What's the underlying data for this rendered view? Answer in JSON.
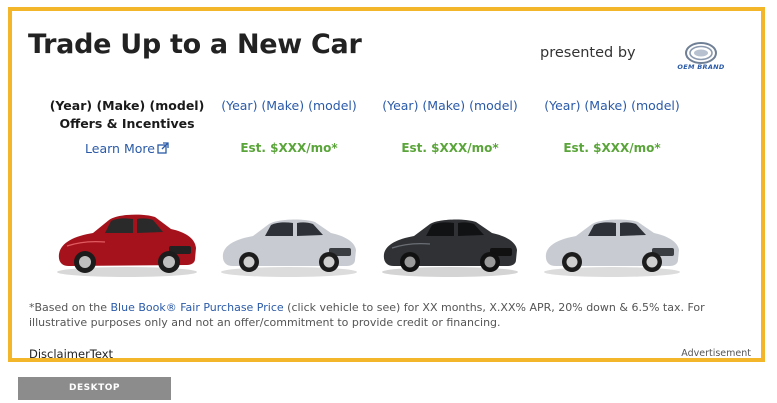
{
  "ad": {
    "title": "Trade Up to a New Car",
    "presented_by": "presented by",
    "brand_logo_text": "OEM BRAND",
    "columns": [
      {
        "heading_line1": "(Year) (Make) (model)",
        "heading_line2": "Offers & Incentives",
        "link_label": "Learn More",
        "link_icon": "external-link-icon",
        "car_color": "#a5121b"
      },
      {
        "heading_line1": "(Year) (Make) (model)",
        "price": "Est. $XXX/mo*",
        "car_color": "#c8ccd2"
      },
      {
        "heading_line1": "(Year) (Make) (model)",
        "price": "Est. $XXX/mo*",
        "car_color": "#2f3134"
      },
      {
        "heading_line1": "(Year) (Make) (model)",
        "price": "Est. $XXX/mo*",
        "car_color": "#c8ccd2"
      }
    ],
    "footnote_prefix": "*Based on the ",
    "footnote_link": "Blue Book® Fair Purchase Price",
    "footnote_suffix": " (click vehicle to see) for XX months, X.XX% APR, 20% down & 6.5% tax. For illustrative purposes only and not an offer/commitment to provide credit or financing.",
    "disclaimer": "DisclaimerText",
    "advertisement_label": "Advertisement"
  },
  "device_label": "DESKTOP",
  "colors": {
    "border": "#f3b52a",
    "link_blue": "#2a5aa8",
    "price_green": "#5aa53a"
  }
}
